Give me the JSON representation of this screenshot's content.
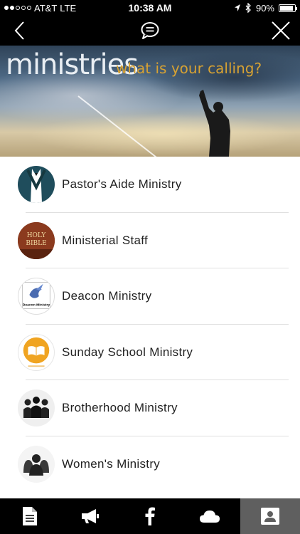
{
  "status_bar": {
    "carrier": "AT&T",
    "network": "LTE",
    "time": "10:38 AM",
    "battery": "90%",
    "battery_level": 0.9,
    "icons": [
      "signal-dots-icon",
      "location-arrow-icon",
      "bluetooth-icon",
      "battery-icon"
    ]
  },
  "nav": {
    "back_icon": "chevron-left-icon",
    "center_icon": "chat-bubble-icon",
    "close_icon": "close-icon"
  },
  "banner": {
    "title": "ministries",
    "subtitle": "what is your calling?"
  },
  "ministries": [
    {
      "label": "Pastor's Aide Ministry",
      "icon": "suit-icon"
    },
    {
      "label": "Ministerial Staff",
      "icon": "holy-bible-icon",
      "icon_text_1": "HOLY",
      "icon_text_2": "BIBLE"
    },
    {
      "label": "Deacon Ministry",
      "icon": "dove-icon",
      "icon_text": "Deacon Ministry"
    },
    {
      "label": "Sunday School Ministry",
      "icon": "open-book-icon"
    },
    {
      "label": "Brotherhood Ministry",
      "icon": "group-of-men-icon"
    },
    {
      "label": "Women's Ministry",
      "icon": "group-of-women-icon"
    }
  ],
  "tabs": [
    {
      "icon": "document-icon",
      "active": false
    },
    {
      "icon": "megaphone-icon",
      "active": false
    },
    {
      "icon": "facebook-icon",
      "active": false
    },
    {
      "icon": "cloud-icon",
      "active": false
    },
    {
      "icon": "contact-card-icon",
      "active": true
    }
  ],
  "colors": {
    "bar_background": "#000000",
    "active_tab": "#5f5f5f",
    "banner_subtitle": "#d7a233",
    "separator": "#e0e0e0"
  }
}
